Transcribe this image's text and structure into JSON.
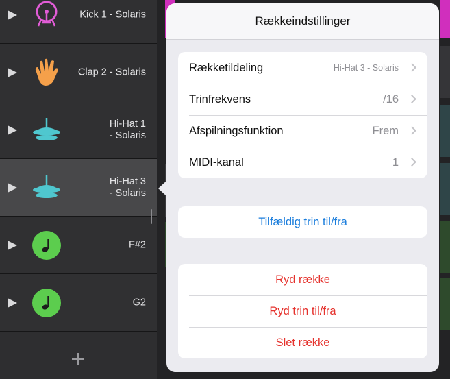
{
  "tracks": [
    {
      "label": "Kick 1 - Solaris",
      "icon": "kick-drum-icon",
      "color": "#e25cd7"
    },
    {
      "label": "Clap 2 - Solaris",
      "icon": "hand-clap-icon",
      "color": "#f5a04a"
    },
    {
      "label": "Hi-Hat 1\n- Solaris",
      "icon": "hihat-cymbal-icon",
      "color": "#4fc7cf"
    },
    {
      "label": "Hi-Hat 3\n- Solaris",
      "icon": "hihat-cymbal-icon",
      "color": "#4fc7cf"
    },
    {
      "label": "F#2",
      "icon": "music-note-icon",
      "color": "#5ccd4e"
    },
    {
      "label": "G2",
      "icon": "music-note-icon",
      "color": "#5ccd4e"
    }
  ],
  "add_button": "+",
  "popover": {
    "title": "Rækkeindstillinger",
    "settings": [
      {
        "label": "Rækketildeling",
        "value": "Hi-Hat 3 - Solaris"
      },
      {
        "label": "Trinfrekvens",
        "value": "/16"
      },
      {
        "label": "Afspilningsfunktion",
        "value": "Frem"
      },
      {
        "label": "MIDI-kanal",
        "value": "1"
      }
    ],
    "random_steps": "Tilfældig trin til/fra",
    "actions": {
      "clear_row": "Ryd række",
      "clear_steps": "Ryd trin til/fra",
      "delete_row": "Slet række"
    }
  },
  "colors": {
    "accent_blue": "#1a7ddc",
    "destructive_red": "#e5322d"
  }
}
